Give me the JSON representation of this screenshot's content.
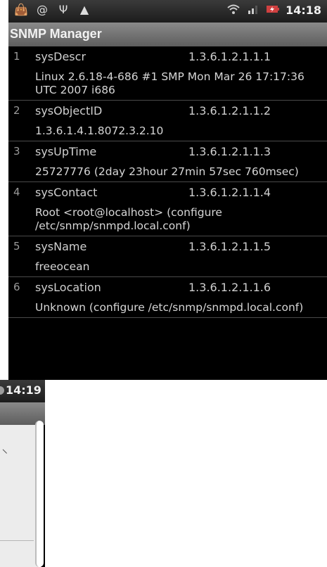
{
  "status_bar": {
    "time": "14:18",
    "left_icons": [
      "bag-icon",
      "at-icon",
      "usb-icon",
      "warning-icon"
    ],
    "right_icons": [
      "wifi-icon",
      "signal-icon",
      "battery-charging-icon"
    ]
  },
  "app": {
    "title": "SNMP Manager"
  },
  "rows": [
    {
      "index": "1",
      "name": "sysDescr",
      "oid": "1.3.6.1.2.1.1.1",
      "value": "Linux  2.6.18-4-686 #1 SMP Mon Mar 26 17:17:36 UTC 2007 i686"
    },
    {
      "index": "2",
      "name": "sysObjectID",
      "oid": "1.3.6.1.2.1.1.2",
      "value": "1.3.6.1.4.1.8072.3.2.10"
    },
    {
      "index": "3",
      "name": "sysUpTime",
      "oid": "1.3.6.1.2.1.1.3",
      "value": "25727776 (2day  23hour  27min  57sec  760msec)"
    },
    {
      "index": "4",
      "name": "sysContact",
      "oid": "1.3.6.1.2.1.1.4",
      "value": "Root <root@localhost> (configure /etc/snmp/snmpd.local.conf)"
    },
    {
      "index": "5",
      "name": "sysName",
      "oid": "1.3.6.1.2.1.1.5",
      "value": "freeocean"
    },
    {
      "index": "6",
      "name": "sysLocation",
      "oid": "1.3.6.1.2.1.1.6",
      "value": "Unknown (configure /etc/snmp/snmpd.local.conf)"
    }
  ],
  "second_screen": {
    "time": "14:19"
  }
}
